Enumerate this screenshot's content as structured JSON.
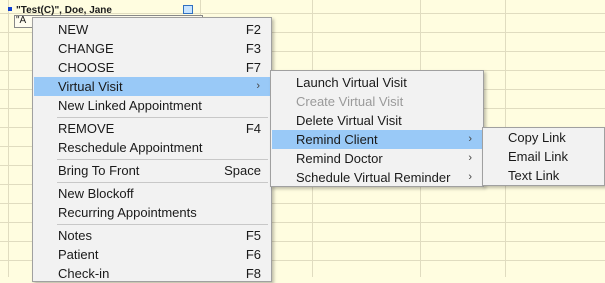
{
  "appointment": {
    "name": "\"Test(C)\", Doe, Jane",
    "second_line": "\"A"
  },
  "colors": {
    "grid_background": "#fffde0",
    "grid_line": "#e0dcc0",
    "menu_background": "#f2f2f2",
    "highlight": "#99c9f7",
    "disabled_text": "#9a9a9a"
  },
  "main_menu": [
    {
      "label": "NEW",
      "shortcut": "F2"
    },
    {
      "label": "CHANGE",
      "shortcut": "F3"
    },
    {
      "label": "CHOOSE",
      "shortcut": "F7"
    },
    {
      "label": "Virtual Visit",
      "submenu": true,
      "highlighted": true
    },
    {
      "label": "New Linked Appointment"
    },
    {
      "label": "REMOVE",
      "shortcut": "F4"
    },
    {
      "label": "Reschedule Appointment"
    },
    {
      "label": "Bring To Front",
      "shortcut": "Space"
    },
    {
      "label": "New Blockoff"
    },
    {
      "label": "Recurring Appointments"
    },
    {
      "label": "Notes",
      "shortcut": "F5"
    },
    {
      "label": "Patient",
      "shortcut": "F6"
    },
    {
      "label": "Check-in",
      "shortcut": "F8"
    }
  ],
  "virtual_visit_menu": [
    {
      "label": "Launch Virtual Visit"
    },
    {
      "label": "Create Virtual Visit",
      "disabled": true
    },
    {
      "label": "Delete Virtual Visit"
    },
    {
      "label": "Remind Client",
      "submenu": true,
      "highlighted": true
    },
    {
      "label": "Remind Doctor",
      "submenu": true
    },
    {
      "label": "Schedule Virtual Reminder",
      "submenu": true
    }
  ],
  "remind_client_menu": [
    {
      "label": "Copy Link"
    },
    {
      "label": "Email Link"
    },
    {
      "label": "Text Link"
    }
  ]
}
